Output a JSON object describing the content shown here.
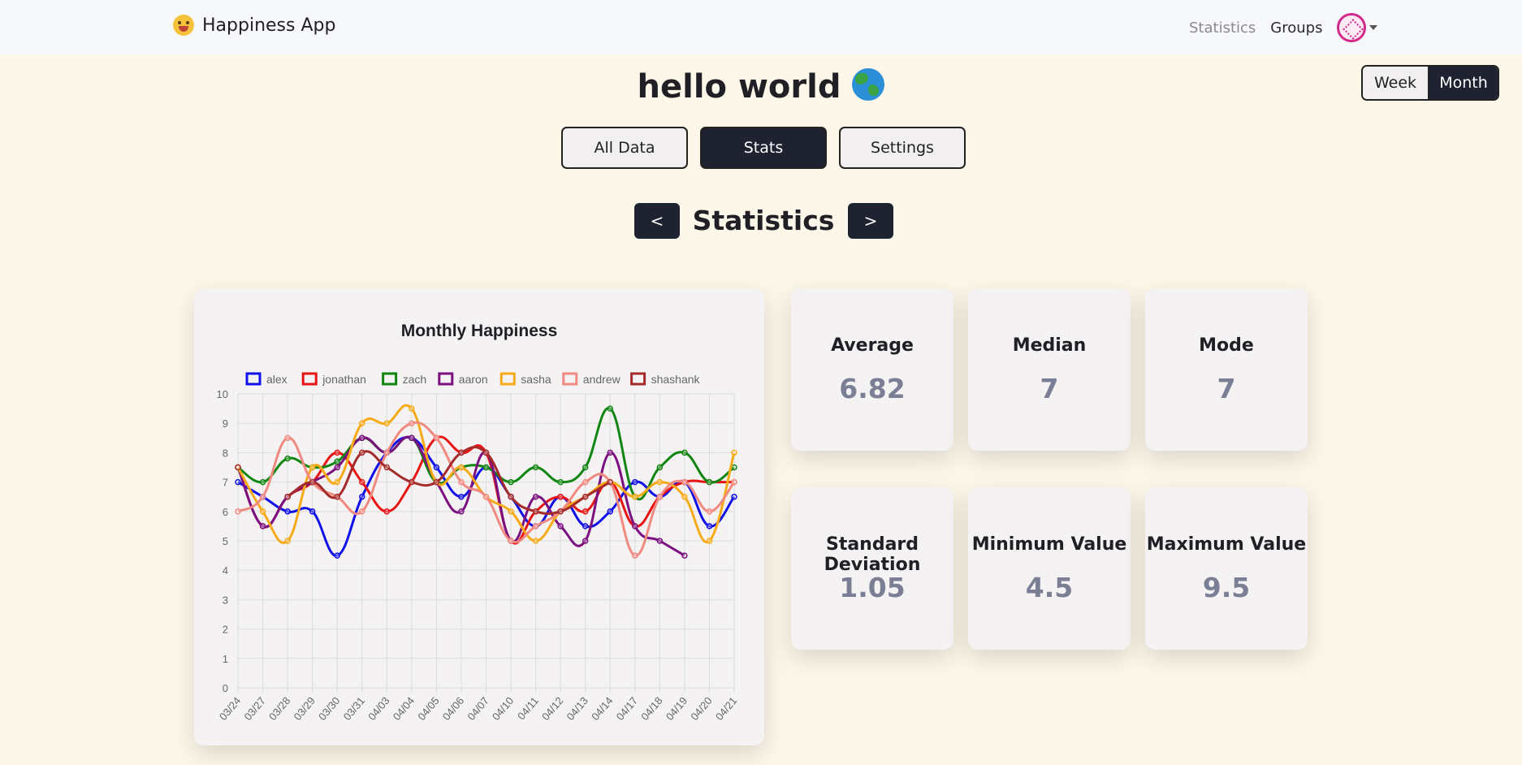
{
  "navbar": {
    "brand": "Happiness App",
    "links": [
      "Statistics",
      "Groups"
    ]
  },
  "period_toggle": {
    "week": "Week",
    "month": "Month",
    "selected": "Month"
  },
  "group_title": "hello world",
  "tabs": {
    "all_data": "All Data",
    "stats": "Stats",
    "settings": "Settings",
    "selected": "Stats"
  },
  "stats_nav": {
    "prev": "<",
    "title": "Statistics",
    "next": ">"
  },
  "stats": {
    "average": {
      "label": "Average",
      "value": "6.82"
    },
    "median": {
      "label": "Median",
      "value": "7"
    },
    "mode": {
      "label": "Mode",
      "value": "7"
    },
    "std_dev": {
      "label": "Standard Deviation",
      "value": "1.05"
    },
    "min": {
      "label": "Minimum Value",
      "value": "4.5"
    },
    "max": {
      "label": "Maximum Value",
      "value": "9.5"
    }
  },
  "chart_data": {
    "type": "line",
    "title": "Monthly Happiness",
    "legend_position": "top",
    "grid": true,
    "ylim": [
      0,
      10
    ],
    "yticks": [
      0,
      1,
      2,
      3,
      4,
      5,
      6,
      7,
      8,
      9,
      10
    ],
    "categories": [
      "03/24",
      "03/27",
      "03/28",
      "03/29",
      "03/30",
      "03/31",
      "04/03",
      "04/04",
      "04/05",
      "04/06",
      "04/07",
      "04/10",
      "04/11",
      "04/12",
      "04/13",
      "04/14",
      "04/17",
      "04/18",
      "04/19",
      "04/20",
      "04/21"
    ],
    "series": [
      {
        "name": "alex",
        "color": "#1010e8",
        "values": [
          7,
          6.5,
          6,
          6,
          4.5,
          6.5,
          8,
          8.5,
          7.5,
          6.5,
          7.5,
          6.5,
          5.5,
          6.5,
          5.5,
          6,
          7,
          6.5,
          7,
          5.5,
          6.5
        ]
      },
      {
        "name": "jonathan",
        "color": "#e81414",
        "values": [
          7.5,
          5.5,
          6.5,
          7,
          8,
          7,
          6,
          7,
          8.5,
          8,
          8,
          5,
          6,
          6.5,
          6,
          7,
          5.5,
          6.5,
          7,
          7,
          7
        ]
      },
      {
        "name": "zach",
        "color": "#118511",
        "values": [
          7.5,
          7,
          7.8,
          7.5,
          7.7,
          8.5,
          8,
          8.5,
          7,
          7.5,
          7.5,
          7,
          7.5,
          7,
          7.5,
          9.5,
          6.5,
          7.5,
          8,
          7,
          7.5
        ]
      },
      {
        "name": "aaron",
        "color": "#7b1080",
        "values": [
          7.5,
          5.5,
          6.5,
          7,
          7.5,
          8.5,
          8,
          8.5,
          7,
          6,
          8,
          5,
          6.5,
          5.5,
          5,
          8,
          5.5,
          5,
          4.5,
          null,
          null
        ]
      },
      {
        "name": "sasha",
        "color": "#f7aa17",
        "values": [
          7.5,
          6,
          5,
          7.5,
          7,
          9,
          9,
          9.5,
          7,
          7.5,
          6.5,
          6,
          5,
          6,
          6.5,
          7,
          6.5,
          7,
          6.5,
          5,
          8
        ]
      },
      {
        "name": "andrew",
        "color": "#f08a80",
        "values": [
          6,
          6.5,
          8.5,
          7,
          6.5,
          6,
          8,
          9,
          8.5,
          7,
          6.5,
          5,
          5.5,
          6,
          7,
          7,
          4.5,
          6.5,
          7,
          6,
          7
        ]
      },
      {
        "name": "shashank",
        "color": "#a52a2a",
        "values": [
          7.5,
          null,
          6.5,
          7,
          6.5,
          8,
          7.5,
          7,
          7,
          8,
          8,
          6.5,
          6,
          6,
          6.5,
          7,
          null,
          null,
          null,
          null,
          null
        ]
      }
    ]
  }
}
